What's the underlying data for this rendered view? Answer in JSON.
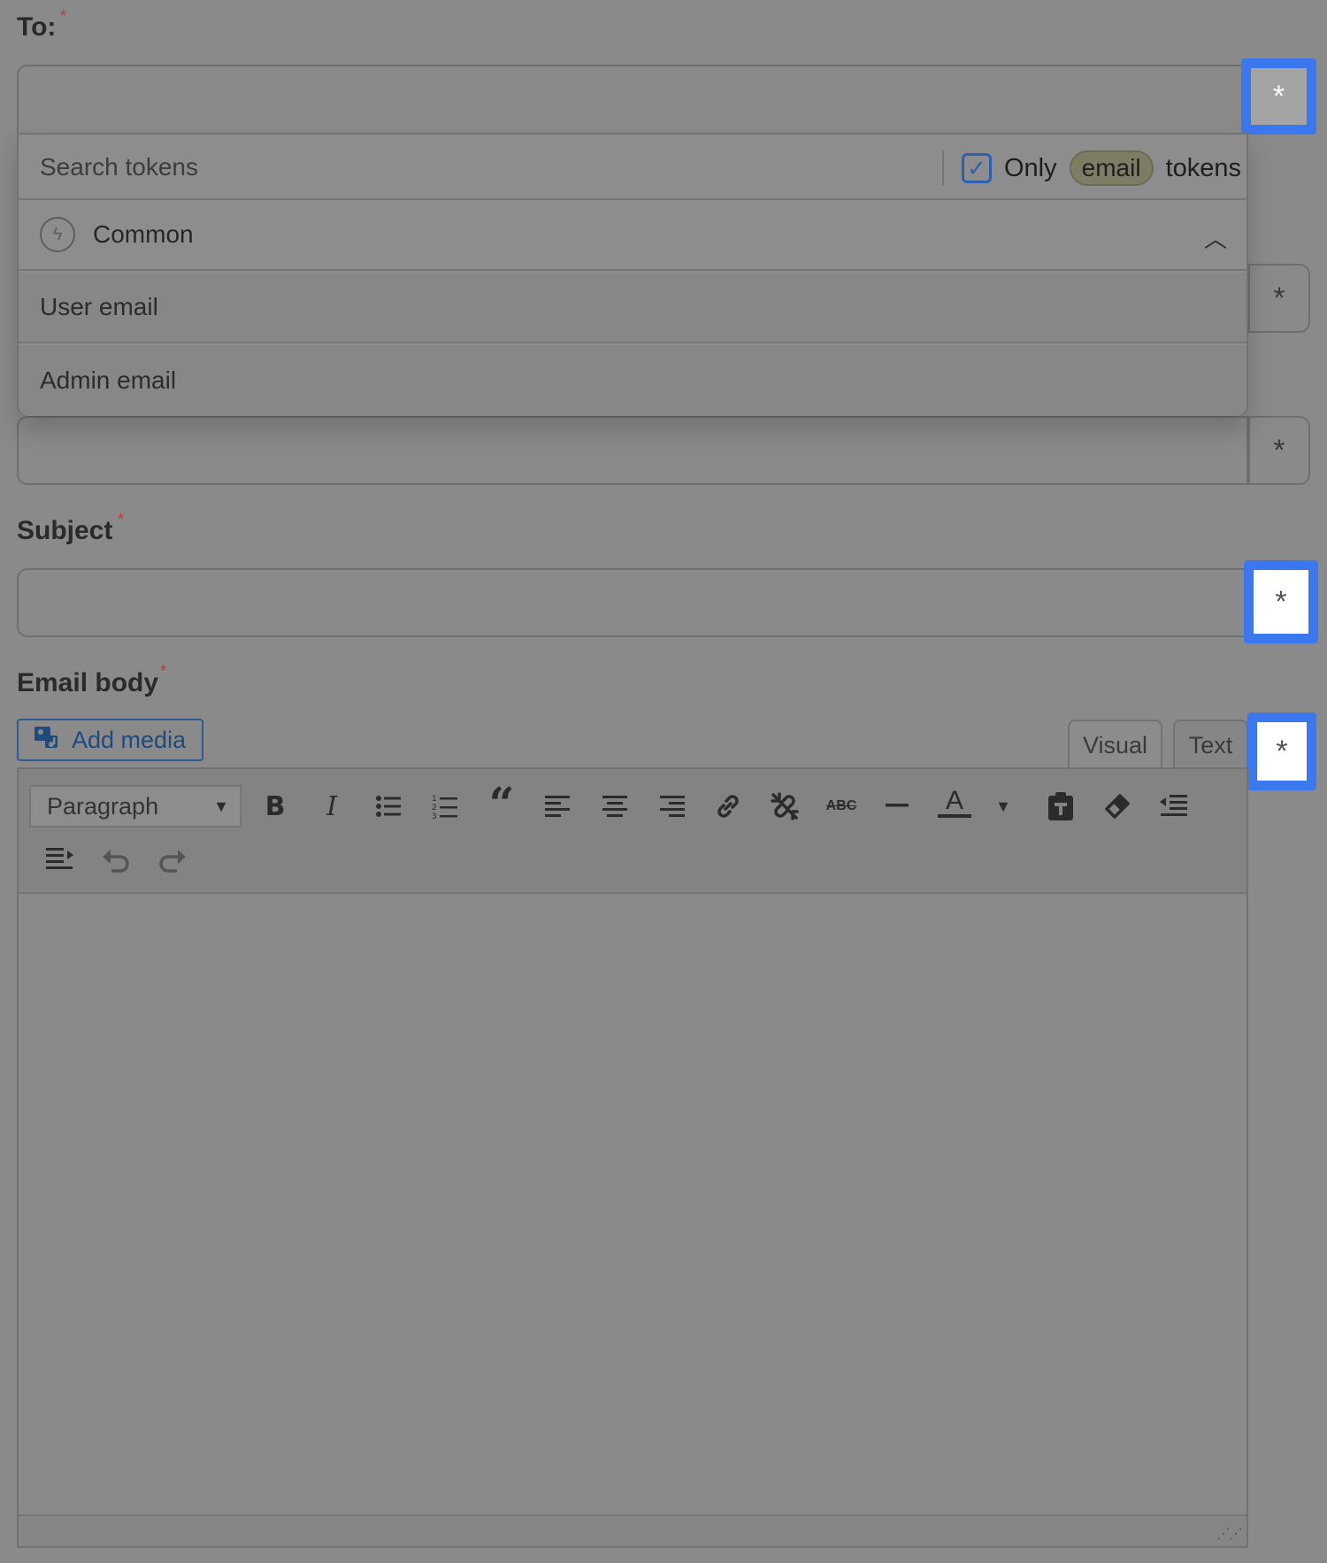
{
  "to": {
    "label": "To:",
    "required_mark": "*",
    "token_button": "*"
  },
  "token_dropdown": {
    "search_placeholder": "Search tokens",
    "only_label": "Only",
    "filter_pill": "email",
    "tokens_label": "tokens",
    "group": {
      "label": "Common",
      "icon": "lightning-circle-icon"
    },
    "items": [
      {
        "label": "User email"
      },
      {
        "label": "Admin email"
      }
    ]
  },
  "extra_fields": [
    {
      "token_button": "*"
    },
    {
      "token_button": "*"
    }
  ],
  "subject": {
    "label": "Subject",
    "required_mark": "*",
    "token_button": "*"
  },
  "email_body": {
    "label": "Email body",
    "required_mark": "*",
    "add_media_label": "Add media",
    "tabs": [
      "Visual",
      "Text"
    ],
    "token_button": "*",
    "format_select": "Paragraph",
    "toolbar_icons": [
      "bold-icon",
      "italic-icon",
      "bullet-list-icon",
      "numbered-list-icon",
      "blockquote-icon",
      "align-left-icon",
      "align-center-icon",
      "align-right-icon",
      "link-icon",
      "unlink-icon",
      "strikethrough-icon",
      "horizontal-rule-icon",
      "text-color-icon",
      "paste-text-icon",
      "clear-formatting-icon",
      "outdent-icon",
      "indent-icon",
      "undo-icon",
      "redo-icon"
    ]
  },
  "colors": {
    "overlay_bg": "#8a8a8a",
    "highlight_border": "#3b78f0",
    "required_mark": "#c0393b",
    "link_blue": "#2f5b8f"
  }
}
